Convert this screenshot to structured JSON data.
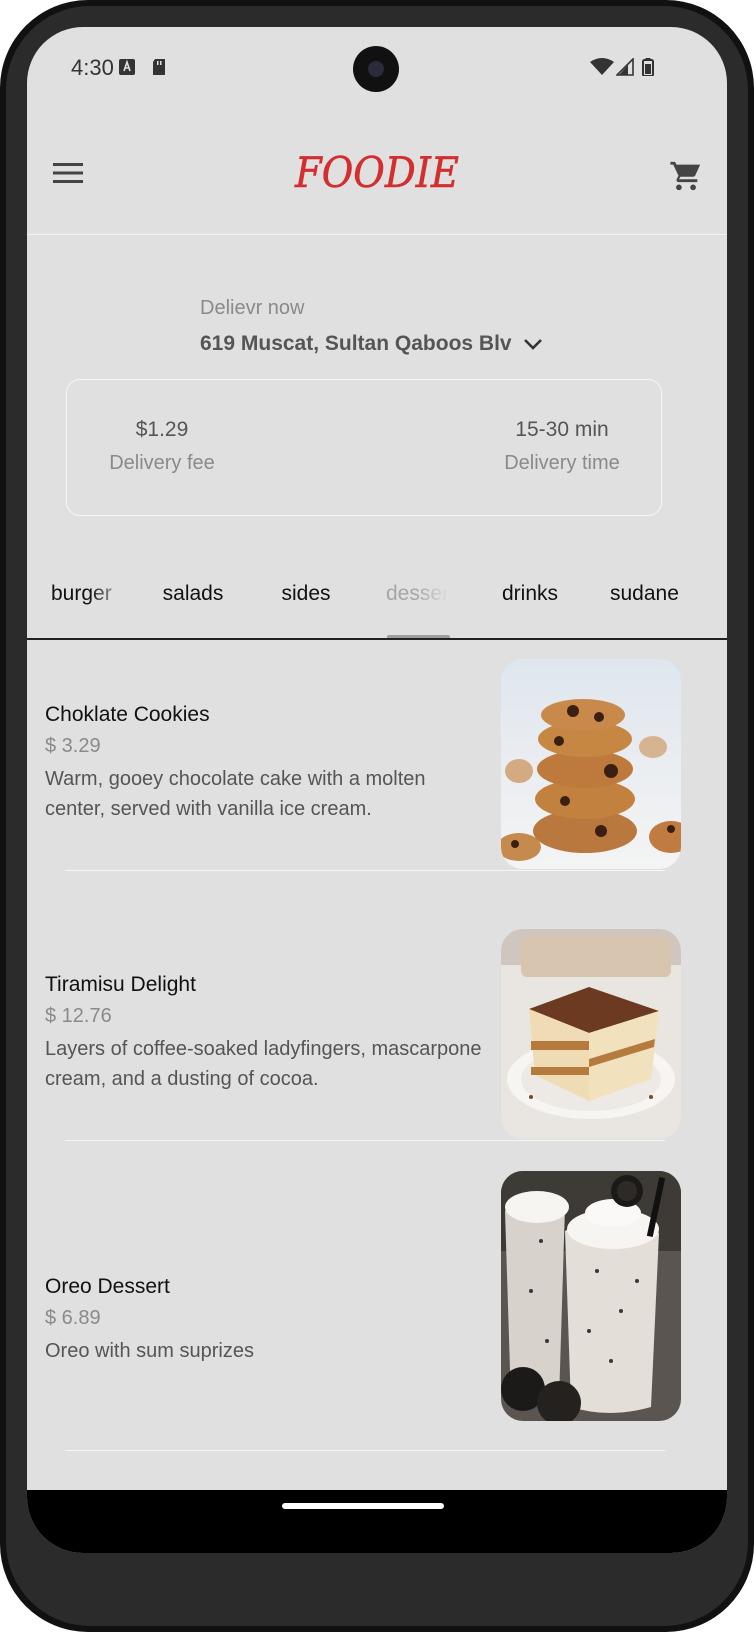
{
  "status_bar": {
    "time": "4:30"
  },
  "app_bar": {
    "logo_text": "FOODIE",
    "brand_color": "#d32f2f"
  },
  "delivery": {
    "label": "Delievr now",
    "address": "619 Muscat, Sultan Qaboos Blv",
    "fee_value": "$1.29",
    "fee_label": "Delivery fee",
    "time_value": "15-30 min",
    "time_label": "Delivery time"
  },
  "tabs": [
    {
      "label": "burger"
    },
    {
      "label": "salads"
    },
    {
      "label": "sides"
    },
    {
      "label": "desser"
    },
    {
      "label": "drinks"
    },
    {
      "label": "sudane"
    }
  ],
  "active_tab": "desserts",
  "items": [
    {
      "name": "Choklate Cookies",
      "price": "$ 3.29",
      "description": "Warm, gooey chocolate cake with a molten center, served with vanilla ice cream."
    },
    {
      "name": "Tiramisu Delight",
      "price": "$ 12.76",
      "description": "Layers of coffee-soaked ladyfingers, mascarpone cream, and a dusting of cocoa."
    },
    {
      "name": "Oreo Dessert",
      "price": "$ 6.89",
      "description": "Oreo with sum suprizes"
    }
  ]
}
